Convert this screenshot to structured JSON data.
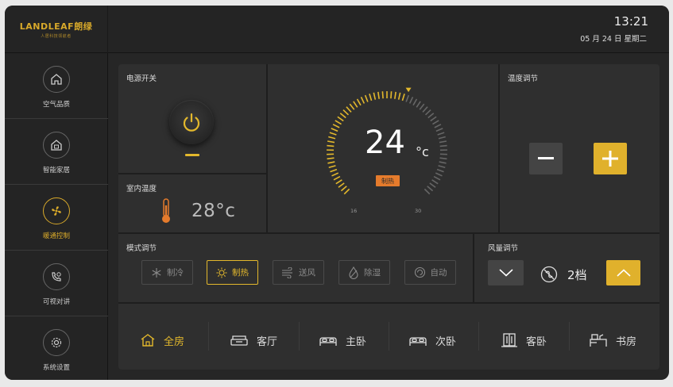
{
  "header": {
    "logo_text": "LANDLEAF朗绿",
    "logo_subtext": "人居科技领航者",
    "time": "13:21",
    "date": "05 月 24 日  星期二"
  },
  "sidebar": {
    "items": [
      {
        "label": "空气品质",
        "icon": "home-icon",
        "active": false
      },
      {
        "label": "智能家居",
        "icon": "smart-home-icon",
        "active": false
      },
      {
        "label": "暖通控制",
        "icon": "fan-icon",
        "active": true
      },
      {
        "label": "可视对讲",
        "icon": "intercom-icon",
        "active": false
      },
      {
        "label": "系统设置",
        "icon": "gear-icon",
        "active": false
      }
    ]
  },
  "power": {
    "title": "电源开关",
    "state": "on"
  },
  "indoor": {
    "title": "室内温度",
    "value": "28°c"
  },
  "gauge": {
    "temperature": "24",
    "unit": "°c",
    "mode_badge": "制热",
    "min_label": "16",
    "max_label": "30",
    "min": 16,
    "max": 30,
    "setpoint": 24
  },
  "temp_adjust": {
    "title": "温度调节"
  },
  "mode": {
    "title": "模式调节",
    "options": [
      {
        "label": "制冷",
        "icon": "snowflake-icon",
        "active": false
      },
      {
        "label": "制热",
        "icon": "sun-icon",
        "active": true
      },
      {
        "label": "送风",
        "icon": "wind-icon",
        "active": false
      },
      {
        "label": "除湿",
        "icon": "droplet-icon",
        "active": false
      },
      {
        "label": "自动",
        "icon": "auto-icon",
        "active": false
      }
    ]
  },
  "fan": {
    "title": "风量调节",
    "level": "2档"
  },
  "rooms": [
    {
      "label": "全房",
      "icon": "house-icon",
      "active": true
    },
    {
      "label": "客厅",
      "icon": "sofa-icon",
      "active": false
    },
    {
      "label": "主卧",
      "icon": "bed-icon",
      "active": false
    },
    {
      "label": "次卧",
      "icon": "bed-icon",
      "active": false
    },
    {
      "label": "客卧",
      "icon": "wardrobe-icon",
      "active": false
    },
    {
      "label": "书房",
      "icon": "desk-icon",
      "active": false
    }
  ],
  "colors": {
    "accent": "#e3b82c",
    "badge": "#e57b2c",
    "panel": "#2f2f2f",
    "background": "#262626"
  }
}
